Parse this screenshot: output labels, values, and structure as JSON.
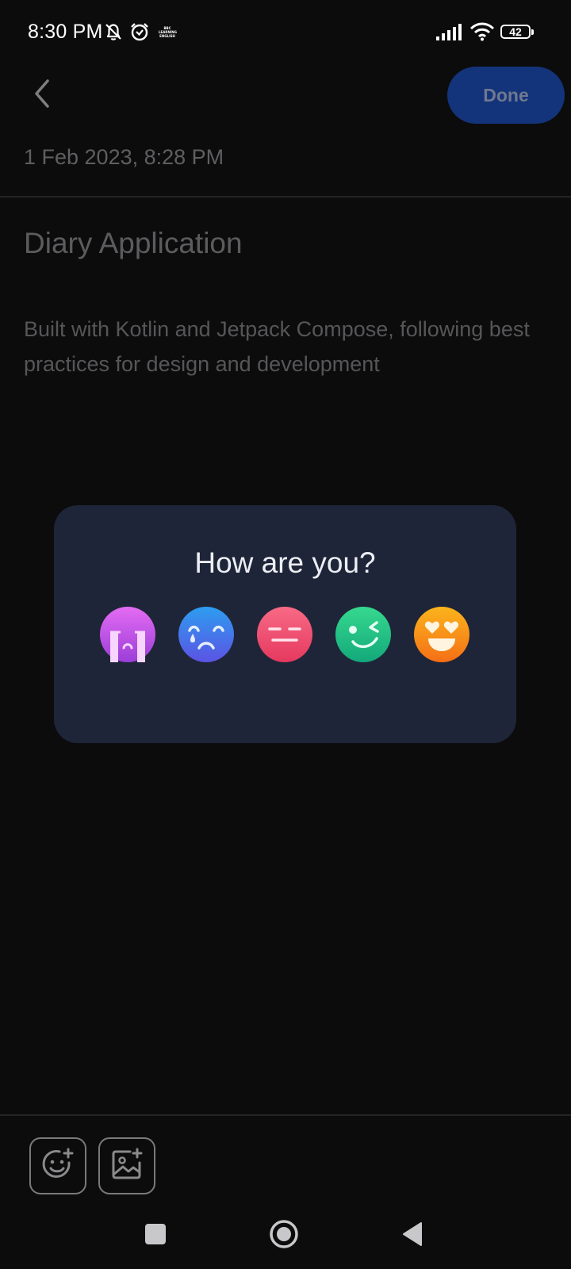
{
  "status_bar": {
    "time": "8:30 PM",
    "icons": [
      "bell-off-icon",
      "alarm-icon",
      "bbc-learning-english-icon",
      "signal-icon",
      "wifi-icon",
      "battery-icon"
    ],
    "bbc_badge_lines": [
      "BBC",
      "LEARNING",
      "ENGLISH"
    ],
    "battery_level": "42"
  },
  "header": {
    "back_icon": "chevron-left-icon",
    "done_label": "Done"
  },
  "entry": {
    "date": "1 Feb 2023, 8:28 PM",
    "title": "Diary Application",
    "body": "Built with Kotlin and Jetpack Compose, following best practices for design and development"
  },
  "mood_dialog": {
    "question": "How are you?",
    "moods": [
      {
        "name": "crying-emoji-icon",
        "color": "#c04ae0"
      },
      {
        "name": "sad-emoji-icon",
        "color": "#3b73e8"
      },
      {
        "name": "neutral-emoji-icon",
        "color": "#ec5277"
      },
      {
        "name": "wink-emoji-icon",
        "color": "#21c47f"
      },
      {
        "name": "heart-eyes-emoji-icon",
        "color": "#f3921a"
      }
    ]
  },
  "toolbar": {
    "buttons": [
      "add-mood-icon",
      "add-image-icon"
    ]
  },
  "nav_bar": {
    "buttons": [
      "recents-icon",
      "home-icon",
      "back-icon"
    ]
  },
  "colors": {
    "background": "#0c0c0d",
    "dialog_background": "#1f2538",
    "done_button": "#13347a"
  }
}
